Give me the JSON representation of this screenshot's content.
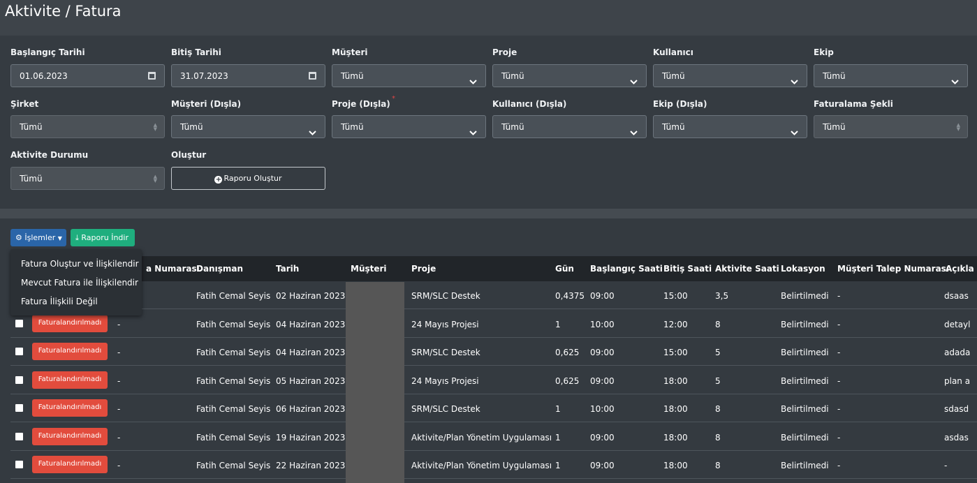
{
  "page": {
    "title": "Aktivite / Fatura"
  },
  "filters": {
    "start_date": {
      "label": "Başlangıç Tarihi",
      "value": "01.06.2023"
    },
    "end_date": {
      "label": "Bitiş Tarihi",
      "value": "31.07.2023"
    },
    "customer": {
      "label": "Müşteri",
      "value": "Tümü"
    },
    "project": {
      "label": "Proje",
      "value": "Tümü"
    },
    "user": {
      "label": "Kullanıcı",
      "value": "Tümü"
    },
    "team": {
      "label": "Ekip",
      "value": "Tümü"
    },
    "company": {
      "label": "Şirket",
      "value": "Tümü"
    },
    "customer_exclude": {
      "label": "Müşteri (Dışla)",
      "value": "Tümü"
    },
    "project_exclude": {
      "label": "Proje (Dışla)",
      "value": "Tümü",
      "required_mark": "*"
    },
    "user_exclude": {
      "label": "Kullanıcı (Dışla)",
      "value": "Tümü"
    },
    "team_exclude": {
      "label": "Ekip (Dışla)",
      "value": "Tümü"
    },
    "billing_type": {
      "label": "Faturalama Şekli",
      "value": "Tümü"
    },
    "activity_status": {
      "label": "Aktivite Durumu",
      "value": "Tümü"
    },
    "create": {
      "label": "Oluştur",
      "button_label": "Raporu Oluştur"
    }
  },
  "toolbar": {
    "operations_label": "İşlemler",
    "download_label": "Raporu İndir"
  },
  "operations_menu": [
    "Fatura Oluştur ve İlişkilendir",
    "Mevcut Fatura ile İlişkilendir",
    "Fatura İlişkili Değil"
  ],
  "table": {
    "columns": {
      "request_no_partial": "a Numarası",
      "consultant": "Danışman",
      "date": "Tarih",
      "customer": "Müşteri",
      "project": "Proje",
      "day": "Gün",
      "start_time": "Başlangıç Saati",
      "end_time": "Bitiş Saati",
      "activity_hours": "Aktivite Saati",
      "location": "Lokasyon",
      "customer_request_no": "Müşteri Talep Numarası",
      "description_partial": "Açıkla"
    },
    "rows": [
      {
        "status": "",
        "invoice_no": "",
        "consultant": "Fatih Cemal Seyis",
        "date": "02 Haziran 2023",
        "project": "SRM/SLC Destek",
        "day": "0,4375",
        "start": "09:00",
        "end": "15:00",
        "hours": "3,5",
        "location": "Belirtilmedi",
        "request_no": "-",
        "description": "dsaas"
      },
      {
        "status": "Faturalandırılmadı",
        "invoice_no": "-",
        "consultant": "Fatih Cemal Seyis",
        "date": "04 Haziran 2023",
        "project": "24 Mayıs Projesi",
        "day": "1",
        "start": "10:00",
        "end": "12:00",
        "hours": "8",
        "location": "Belirtilmedi",
        "request_no": "-",
        "description": "detayl"
      },
      {
        "status": "Faturalandırılmadı",
        "invoice_no": "-",
        "consultant": "Fatih Cemal Seyis",
        "date": "04 Haziran 2023",
        "project": "SRM/SLC Destek",
        "day": "0,625",
        "start": "09:00",
        "end": "15:00",
        "hours": "5",
        "location": "Belirtilmedi",
        "request_no": "-",
        "description": "adada"
      },
      {
        "status": "Faturalandırılmadı",
        "invoice_no": "-",
        "consultant": "Fatih Cemal Seyis",
        "date": "05 Haziran 2023",
        "project": "24 Mayıs Projesi",
        "day": "0,625",
        "start": "09:00",
        "end": "18:00",
        "hours": "5",
        "location": "Belirtilmedi",
        "request_no": "-",
        "description": "plan a"
      },
      {
        "status": "Faturalandırılmadı",
        "invoice_no": "-",
        "consultant": "Fatih Cemal Seyis",
        "date": "06 Haziran 2023",
        "project": "SRM/SLC Destek",
        "day": "1",
        "start": "10:00",
        "end": "18:00",
        "hours": "8",
        "location": "Belirtilmedi",
        "request_no": "-",
        "description": "sdasd"
      },
      {
        "status": "Faturalandırılmadı",
        "invoice_no": "-",
        "consultant": "Fatih Cemal Seyis",
        "date": "19 Haziran 2023",
        "project": "Aktivite/Plan Yönetim Uygulaması",
        "day": "1",
        "start": "09:00",
        "end": "18:00",
        "hours": "8",
        "location": "Belirtilmedi",
        "request_no": "-",
        "description": "asdas"
      },
      {
        "status": "Faturalandırılmadı",
        "invoice_no": "-",
        "consultant": "Fatih Cemal Seyis",
        "date": "22 Haziran 2023",
        "project": "Aktivite/Plan Yönetim Uygulaması",
        "day": "1",
        "start": "09:00",
        "end": "18:00",
        "hours": "8",
        "location": "Belirtilmedi",
        "request_no": "-",
        "description": "-"
      }
    ]
  }
}
